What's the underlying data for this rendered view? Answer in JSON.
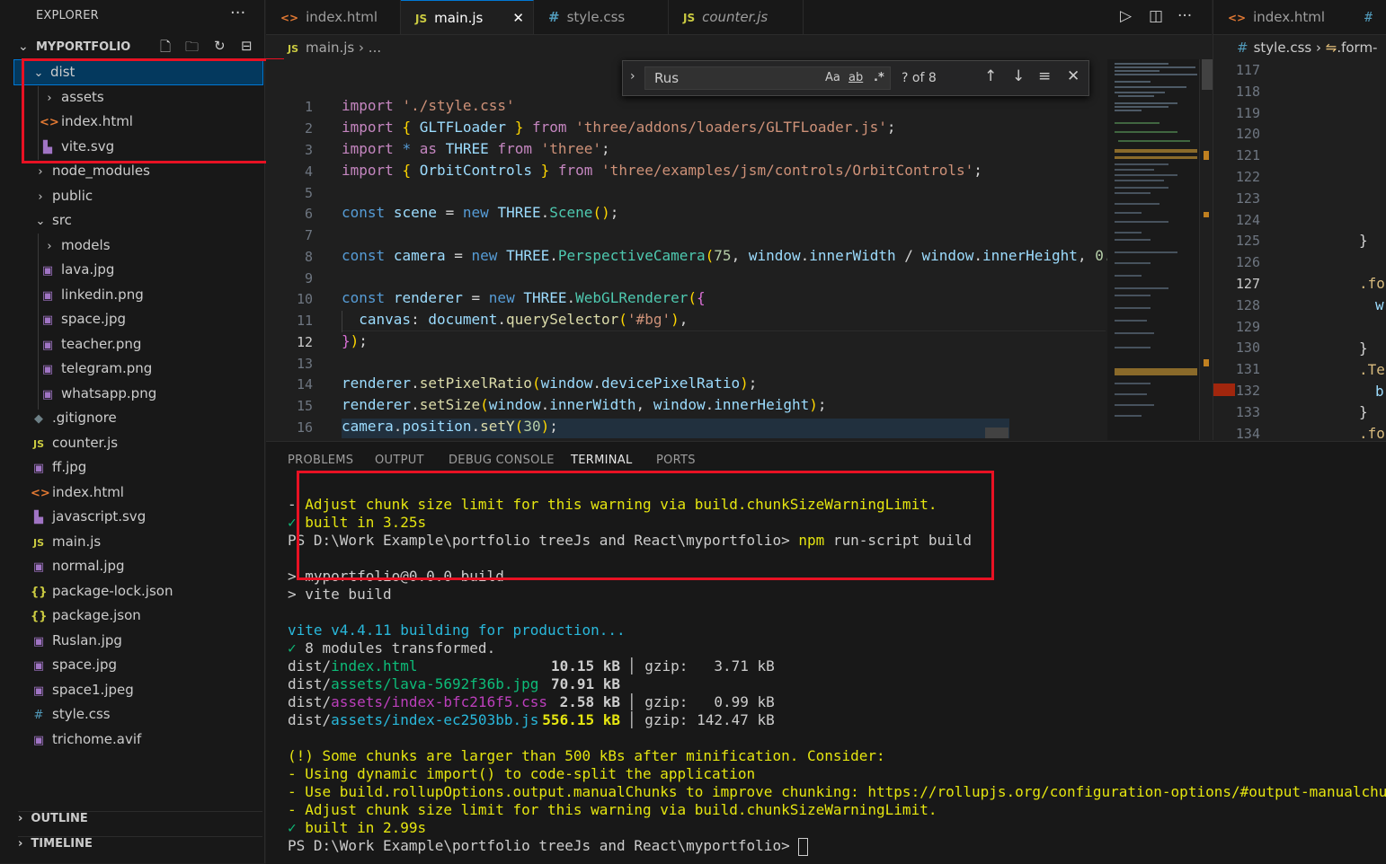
{
  "sidebar": {
    "header": "EXPLORER",
    "more": "···",
    "project": "MYPORTFOLIO",
    "items": [
      {
        "label": "dist",
        "icon": "chevron-down-icon",
        "glyph": "⌄"
      },
      {
        "label": "assets",
        "icon": "chevron-right-icon",
        "glyph": "›"
      },
      {
        "label": "index.html",
        "icon": "html-file-icon",
        "glyph": "<>"
      },
      {
        "label": "vite.svg",
        "icon": "svg-file-icon",
        "glyph": "▙"
      },
      {
        "label": "node_modules",
        "icon": "chevron-right-icon",
        "glyph": "›"
      },
      {
        "label": "public",
        "icon": "chevron-right-icon",
        "glyph": "›"
      },
      {
        "label": "src",
        "icon": "chevron-down-icon",
        "glyph": "⌄"
      },
      {
        "label": "models",
        "icon": "chevron-right-icon",
        "glyph": "›"
      },
      {
        "label": "lava.jpg",
        "icon": "image-file-icon",
        "glyph": "▣"
      },
      {
        "label": "linkedin.png",
        "icon": "image-file-icon",
        "glyph": "▣"
      },
      {
        "label": "space.jpg",
        "icon": "image-file-icon",
        "glyph": "▣"
      },
      {
        "label": "teacher.png",
        "icon": "image-file-icon",
        "glyph": "▣"
      },
      {
        "label": "telegram.png",
        "icon": "image-file-icon",
        "glyph": "▣"
      },
      {
        "label": "whatsapp.png",
        "icon": "image-file-icon",
        "glyph": "▣"
      },
      {
        "label": ".gitignore",
        "icon": "git-file-icon",
        "glyph": "◆"
      },
      {
        "label": "counter.js",
        "icon": "js-file-icon",
        "glyph": "JS"
      },
      {
        "label": "ff.jpg",
        "icon": "image-file-icon",
        "glyph": "▣"
      },
      {
        "label": "index.html",
        "icon": "html-file-icon",
        "glyph": "<>"
      },
      {
        "label": "javascript.svg",
        "icon": "svg-file-icon",
        "glyph": "▙"
      },
      {
        "label": "main.js",
        "icon": "js-file-icon",
        "glyph": "JS"
      },
      {
        "label": "normal.jpg",
        "icon": "image-file-icon",
        "glyph": "▣"
      },
      {
        "label": "package-lock.json",
        "icon": "json-file-icon",
        "glyph": "{}"
      },
      {
        "label": "package.json",
        "icon": "json-file-icon",
        "glyph": "{}"
      },
      {
        "label": "Ruslan.jpg",
        "icon": "image-file-icon",
        "glyph": "▣"
      },
      {
        "label": "space.jpg",
        "icon": "image-file-icon",
        "glyph": "▣"
      },
      {
        "label": "space1.jpeg",
        "icon": "image-file-icon",
        "glyph": "▣"
      },
      {
        "label": "style.css",
        "icon": "css-file-icon",
        "glyph": "#"
      },
      {
        "label": "trichome.avif",
        "icon": "image-file-icon",
        "glyph": "▣"
      }
    ],
    "outline": "OUTLINE",
    "timeline": "TIMELINE"
  },
  "tabs": [
    {
      "label": "index.html",
      "glyph": "<>"
    },
    {
      "label": "main.js",
      "glyph": "JS"
    },
    {
      "label": "style.css",
      "glyph": "#"
    },
    {
      "label": "counter.js",
      "glyph": "JS"
    }
  ],
  "breadcrumb": {
    "file": "main.js",
    "rest": "› ..."
  },
  "find": {
    "value": "Rus",
    "case": "Aa",
    "word": "ab",
    "regex": ".*",
    "count": "? of 8"
  },
  "editor": {
    "line_numbers": [
      "1",
      "2",
      "3",
      "4",
      "5",
      "6",
      "7",
      "8",
      "9",
      "10",
      "11",
      "12",
      "13",
      "14",
      "15",
      "16"
    ],
    "current_line": "12"
  },
  "right_editor": {
    "tab1": "index.html",
    "tab2": "#",
    "breadcrumb": "style.css › ",
    "breadcrumb2": ".form-",
    "line_numbers": [
      "117",
      "118",
      "119",
      "120",
      "121",
      "122",
      "123",
      "124",
      "125",
      "126",
      "127",
      "128",
      "129",
      "130",
      "131",
      "132",
      "133",
      "134"
    ],
    "frag_close": "}",
    "frag_for": ".for",
    "frag_w": "w",
    "frag_te": ".Te",
    "frag_b": "b",
    "frag_for2": ".for"
  },
  "panel": {
    "tabs": [
      "PROBLEMS",
      "OUTPUT",
      "DEBUG CONSOLE",
      "TERMINAL",
      "PORTS"
    ],
    "active_tab": "TERMINAL",
    "term": {
      "l1a": "- ",
      "l1b": "Adjust chunk size limit for this warning via build.chunkSizeWarningLimit.",
      "l2a": "✓",
      "l2b": " built in 3.25s",
      "l3": "PS D:\\Work Example\\portfolio treeJs and React\\myportfolio> ",
      "l3cmd": "npm",
      "l3rest": " run-script build",
      "l5": "> myportfolio@0.0.0 build",
      "l6": "> vite build",
      "l8": "vite v4.4.11 building for production...",
      "l9a": "✓",
      "l9b": " 8 modules transformed.",
      "f1p": "dist/",
      "f1n": "index.html",
      "f1s": "10.15 kB",
      "f1g": "│ gzip:   3.71 kB",
      "f2p": "dist/",
      "f2n": "assets/lava-5692f36b.jpg",
      "f2s": "70.91 kB",
      "f3p": "dist/",
      "f3n": "assets/index-bfc216f5.css",
      "f3s": "2.58 kB",
      "f3g": "│ gzip:   0.99 kB",
      "f4p": "dist/",
      "f4n": "assets/index-ec2503bb.js",
      "f4s": "556.15 kB",
      "f4g": "│ gzip: 142.47 kB",
      "w1": "(!) Some chunks are larger than 500 kBs after minification. Consider:",
      "w2": "- Using dynamic import() to code-split the application",
      "w3": "- Use build.rollupOptions.output.manualChunks to improve chunking: https://rollupjs.org/configuration-options/#output-manualchunks",
      "w4": "- Adjust chunk size limit for this warning via build.chunkSizeWarningLimit.",
      "b1a": "✓",
      "b1b": " built in 2.99s",
      "prompt": "PS D:\\Work Example\\portfolio treeJs and React\\myportfolio> "
    }
  },
  "colors": {
    "accent": "#0078d4",
    "highlight_box": "#e81123"
  }
}
